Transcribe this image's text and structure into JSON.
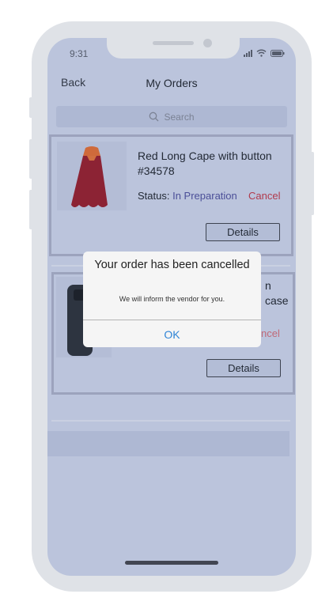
{
  "status_bar": {
    "time": "9:31"
  },
  "header": {
    "back_label": "Back",
    "title": "My Orders"
  },
  "search": {
    "placeholder": "Search"
  },
  "orders": [
    {
      "name_line1": "Red Long Cape with button",
      "name_line2": "#34578",
      "status_label": "Status:",
      "status_value": "In Preparation",
      "cancel_label": "Cancel",
      "details_label": "Details"
    },
    {
      "name_partial": "n case",
      "cancel_partial": "ncel",
      "details_label": "Details"
    }
  ],
  "dialog": {
    "title": "Your order has been cancelled",
    "message": "We will inform the vendor for you.",
    "ok_label": "OK"
  },
  "colors": {
    "screen_bg": "#bbc4dc",
    "accent": "#2f84d6",
    "cancel": "#b13a4c",
    "status": "#4b4f98"
  }
}
